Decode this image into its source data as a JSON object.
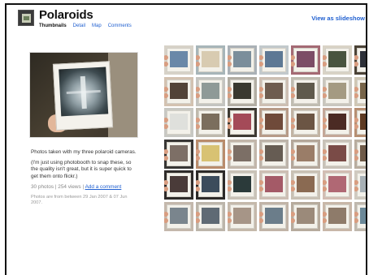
{
  "header": {
    "title": "Polaroids",
    "nav": [
      {
        "label": "Thumbnails",
        "active": true
      },
      {
        "label": "Detail",
        "active": false
      },
      {
        "label": "Map",
        "active": false
      },
      {
        "label": "Comments",
        "active": false
      }
    ],
    "slideshow_label": "View as slideshow",
    "slideshow_paren": "(+"
  },
  "description": {
    "line1": "Photos taken with my three polaroid cameras.",
    "line2": "(I'm just using photobooth to snap these, so the quality isn't great, but it is super quick to get them onto flickr.)",
    "stats": "30 photos | 254 views |",
    "add_comment": "Add a comment",
    "dates": "Photos are from between 29 Jan 2007 & 07 Jun 2007."
  },
  "colors": {
    "link": "#1f5fd0",
    "title": "#111111"
  },
  "thumbnails": [
    {
      "bg": "#d7d2c8",
      "img": "#6a88a8"
    },
    {
      "bg": "#a7b5b9",
      "img": "#d8cbb1"
    },
    {
      "bg": "#aab1b6",
      "img": "#7b8e9b"
    },
    {
      "bg": "#c2c9cc",
      "img": "#5d7894"
    },
    {
      "bg": "#a46a74",
      "img": "#7c4d66"
    },
    {
      "bg": "#d9d3c6",
      "img": "#49543f"
    },
    {
      "bg": "#4b4236",
      "img": "#2d3038"
    },
    {
      "bg": "#d3c2b1",
      "img": "#524338"
    },
    {
      "bg": "#c4c4c0",
      "img": "#8f9a97"
    },
    {
      "bg": "#b2ada3",
      "img": "#3a3930"
    },
    {
      "bg": "#cdbfb3",
      "img": "#6e5c4f"
    },
    {
      "bg": "#c0bdb2",
      "img": "#5f5a4d"
    },
    {
      "bg": "#c9c6be",
      "img": "#a49a82"
    },
    {
      "bg": "#cfc7b5",
      "img": "#776449"
    },
    {
      "bg": "#c8c8c3",
      "img": "#dfe0dc"
    },
    {
      "bg": "#bfb9ad",
      "img": "#7b6e5d"
    },
    {
      "bg": "#3e3a33",
      "img": "#a44a58"
    },
    {
      "bg": "#b79b88",
      "img": "#6f4a3a"
    },
    {
      "bg": "#c2b4a4",
      "img": "#6b5544"
    },
    {
      "bg": "#c4a798",
      "img": "#4b2b24"
    },
    {
      "bg": "#b78f72",
      "img": "#5e3a22"
    },
    {
      "bg": "#383634",
      "img": "#7d6f66"
    },
    {
      "bg": "#b98c6c",
      "img": "#d8c273"
    },
    {
      "bg": "#c2b6aa",
      "img": "#7c6f66"
    },
    {
      "bg": "#bdb4aa",
      "img": "#665c53"
    },
    {
      "bg": "#b4a79a",
      "img": "#9a7d68"
    },
    {
      "bg": "#c8c2b8",
      "img": "#7a4b47"
    },
    {
      "bg": "#b8ad9f",
      "img": "#6e5a48"
    },
    {
      "bg": "#2e2b29",
      "img": "#4a3b39"
    },
    {
      "bg": "#2d2a28",
      "img": "#3c4c5c"
    },
    {
      "bg": "#c9c2b7",
      "img": "#2b3a3a"
    },
    {
      "bg": "#cdbfb4",
      "img": "#a45a67"
    },
    {
      "bg": "#c9c1b4",
      "img": "#8a6a52"
    },
    {
      "bg": "#d2bdb3",
      "img": "#b06874"
    },
    {
      "bg": "#d0cac0",
      "img": "#a7b0b5"
    },
    {
      "bg": "#c4b8ac",
      "img": "#7a858d"
    },
    {
      "bg": "#bcb5aa",
      "img": "#5f6a74"
    },
    {
      "bg": "#c5b9ab",
      "img": "#a69587"
    },
    {
      "bg": "#c1b4a7",
      "img": "#6b7d8a"
    },
    {
      "bg": "#b7ab9d",
      "img": "#9b8a7a"
    },
    {
      "bg": "#c8b7a8",
      "img": "#8e7b6a"
    },
    {
      "bg": "#bfb8ad",
      "img": "#6b8898"
    }
  ]
}
